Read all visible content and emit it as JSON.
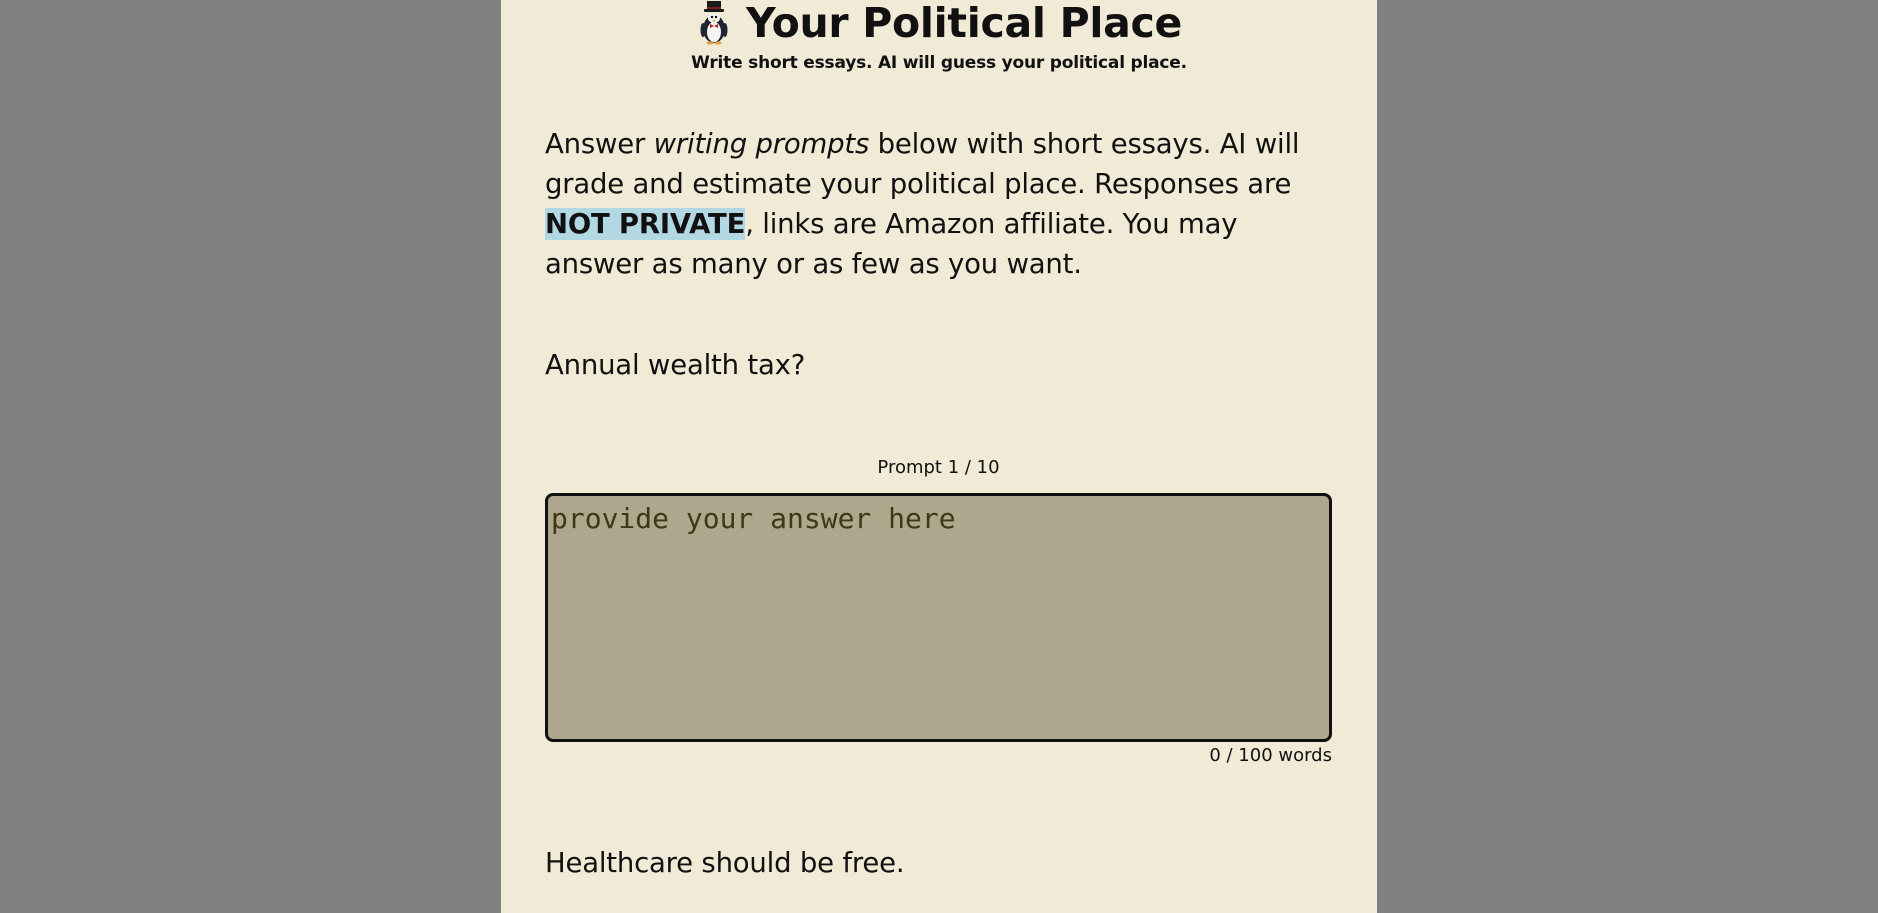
{
  "header": {
    "title": "Your Political Place",
    "subtitle": "Write short essays. AI will guess your political place.",
    "logo_icon": "penguin-tophat-icon"
  },
  "intro": {
    "part1": "Answer ",
    "part2_italic": "writing prompts",
    "part3": " below with short essays. AI will grade and estimate your political place. Responses are ",
    "highlight": "NOT PRIVATE",
    "part4": ", links are Amazon affiliate. You may answer as many or as few as you want."
  },
  "prompts": [
    {
      "text": "Annual wealth tax?",
      "counter": "Prompt 1 / 10",
      "placeholder": "provide your answer here",
      "word_count": "0 / 100 words"
    },
    {
      "text": "Healthcare should be free."
    }
  ],
  "colors": {
    "page_background": "#808080",
    "column_background": "#f1ead7",
    "highlight": "#b2d8e3",
    "textarea_background": "#aea78d"
  }
}
